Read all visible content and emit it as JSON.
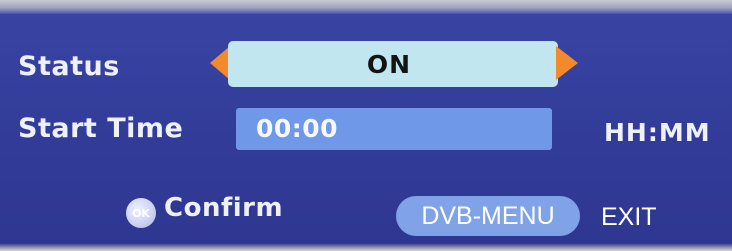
{
  "status": {
    "label": "Status",
    "value": "ON",
    "arrow_color": "#f28a2c"
  },
  "start_time": {
    "label": "Start Time",
    "value": "00:00",
    "format": "HH:MM"
  },
  "footer": {
    "ok_icon_text": "OK",
    "confirm_label": "Confirm",
    "menu_key_label": "DVB-MENU",
    "exit_label": "EXIT"
  },
  "colors": {
    "background": "#3a44a4",
    "selected_field": "#c2e6ef",
    "time_field": "#6f98e8",
    "menu_key": "#7fa3e6"
  },
  "icons": {
    "left": "arrow-left-icon",
    "right": "arrow-right-icon",
    "ok": "ok-button-icon"
  }
}
